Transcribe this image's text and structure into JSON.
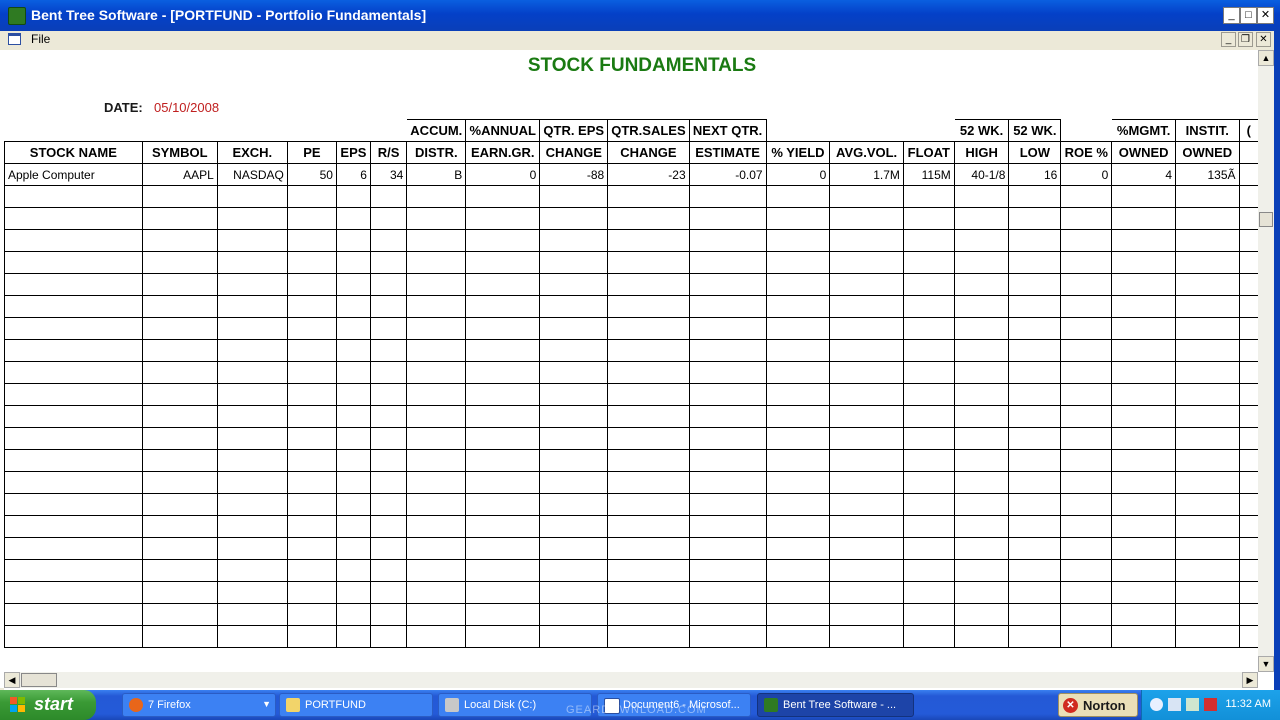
{
  "window": {
    "title": "Bent Tree Software - [PORTFUND - Portfolio Fundamentals]",
    "minimize_symbol": "_",
    "maximize_symbol": "□",
    "close_symbol": "✕"
  },
  "menu": {
    "file_label": "File",
    "mdi_minimize_symbol": "_",
    "mdi_restore_symbol": "❐",
    "mdi_close_symbol": "✕"
  },
  "report": {
    "heading": "STOCK FUNDAMENTALS",
    "date_label": "DATE:",
    "date_value": "05/10/2008"
  },
  "table": {
    "header_top": [
      "",
      "",
      "",
      "",
      "",
      "",
      "ACCUM.",
      "%ANNUAL",
      "QTR. EPS",
      "QTR.SALES",
      "NEXT QTR.",
      "",
      "",
      "",
      "52 WK.",
      "52 WK.",
      "",
      "%MGMT.",
      "INSTIT.",
      "("
    ],
    "header_bottom": [
      "STOCK NAME",
      "SYMBOL",
      "EXCH.",
      "PE",
      "EPS",
      "R/S",
      "DISTR.",
      "EARN.GR.",
      "CHANGE",
      "CHANGE",
      "ESTIMATE",
      "% YIELD",
      "AVG.VOL.",
      "FLOAT",
      "HIGH",
      "LOW",
      "ROE %",
      "OWNED",
      "OWNED",
      ""
    ],
    "rows": [
      [
        "Apple Computer",
        "AAPL",
        "NASDAQ",
        "50",
        "6",
        "34",
        "B",
        "0",
        "-88",
        "-23",
        "-0.07",
        "0",
        "1.7M",
        "115M",
        "40-1/8",
        "16",
        "0",
        "4",
        "135Ã",
        ""
      ]
    ],
    "empty_rows": 21
  },
  "scrollbars": {
    "up": "▲",
    "down": "▼",
    "left": "◀",
    "right": "▶"
  },
  "taskbar": {
    "start_label": "start",
    "tasks": [
      {
        "label": "7 Firefox",
        "icon": "firefox-icon",
        "caret": "▼"
      },
      {
        "label": "PORTFUND",
        "icon": "folder-icon"
      },
      {
        "label": "Local Disk (C:)",
        "icon": "drive-icon"
      },
      {
        "label": "Document6 - Microsof...",
        "icon": "word-icon"
      },
      {
        "label": "Bent Tree Software - ...",
        "icon": "bent-tree-icon"
      }
    ],
    "norton_label": "Norton",
    "clock": "11:32 AM",
    "watermark": "GEARDOWNLOAD.COM"
  },
  "colors": {
    "heading": "#1a7a12",
    "date_value": "#c02020",
    "titlebar": "#0a5fe0",
    "taskbar": "#245ad8"
  }
}
